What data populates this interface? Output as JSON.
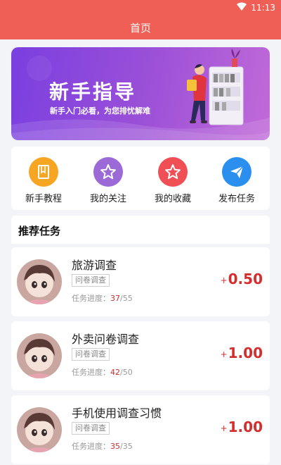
{
  "status": {
    "time": "11:13"
  },
  "header": {
    "title": "首页"
  },
  "banner": {
    "title": "新手指导",
    "subtitle": "新手入门必看，为您排忧解难"
  },
  "quick_actions": [
    {
      "label": "新手教程",
      "icon": "book-icon",
      "color": "#f6a623"
    },
    {
      "label": "我的关注",
      "icon": "star-outline-icon",
      "color": "#9b6ad6"
    },
    {
      "label": "我的收藏",
      "icon": "star-outline-icon",
      "color": "#ef4f55"
    },
    {
      "label": "发布任务",
      "icon": "paper-plane-icon",
      "color": "#2b8ff0"
    }
  ],
  "section": {
    "title": "推荐任务"
  },
  "progress_label": "任务进度：",
  "tasks": [
    {
      "title": "旅游调查",
      "tag": "问卷调查",
      "done": "37",
      "total": "/55",
      "plus": "+",
      "reward": "0.50"
    },
    {
      "title": "外卖问卷调查",
      "tag": "问卷调查",
      "done": "42",
      "total": "/50",
      "plus": "+",
      "reward": "1.00"
    },
    {
      "title": "手机使用调查习惯",
      "tag": "问卷调查",
      "done": "35",
      "total": "/35",
      "plus": "+",
      "reward": "1.00"
    }
  ],
  "colors": {
    "accent": "#ef5f56",
    "reward": "#d42d2d"
  }
}
